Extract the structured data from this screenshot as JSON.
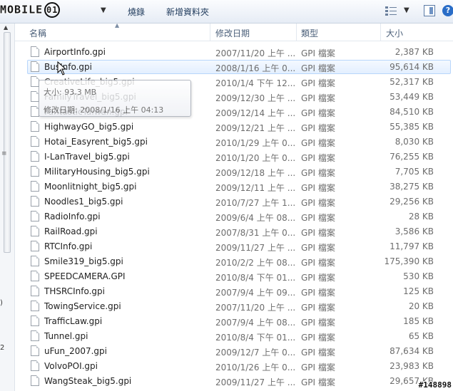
{
  "toolbar": {
    "logo_text": "MOBILE",
    "logo_ring": "01",
    "organize_label": "組合管理",
    "burn_label": "燒錄",
    "new_folder_label": "新增資料夾"
  },
  "left_strip_glyphs": [
    ")",
    "2"
  ],
  "columns": {
    "name": "名稱",
    "date": "修改日期",
    "type": "類型",
    "size": "大小"
  },
  "files": [
    {
      "name": "AirportInfo.gpi",
      "date": "2007/11/20 上午 ...",
      "type": "GPI 檔案",
      "size": "2,387 KB"
    },
    {
      "name": "BusInfo.gpi",
      "date": "2008/1/16 上午 0...",
      "type": "GPI 檔案",
      "size": "95,614 KB"
    },
    {
      "name": "CreativeLife_big5.gpi",
      "date": "2010/1/4 下午 12...",
      "type": "GPI 檔案",
      "size": "52,317 KB"
    },
    {
      "name": "FamilyTravel_big5.gpi",
      "date": "2009/12/30 上午 ...",
      "type": "GPI 檔案",
      "size": "53,449 KB"
    },
    {
      "name": "FantasticTaiwan.gpi",
      "date": "2009/12/14 上午 ...",
      "type": "GPI 檔案",
      "size": "84,510 KB"
    },
    {
      "name": "HighwayGO_big5.gpi",
      "date": "2009/12/21 上午 ...",
      "type": "GPI 檔案",
      "size": "55,385 KB"
    },
    {
      "name": "Hotai_Easyrent_big5.gpi",
      "date": "2010/1/29 上午 0...",
      "type": "GPI 檔案",
      "size": "8,030 KB"
    },
    {
      "name": "I-LanTravel_big5.gpi",
      "date": "2010/1/20 上午 0...",
      "type": "GPI 檔案",
      "size": "76,255 KB"
    },
    {
      "name": "MilitaryHousing_big5.gpi",
      "date": "2009/12/18 上午 ...",
      "type": "GPI 檔案",
      "size": "7,705 KB"
    },
    {
      "name": "Moonlitnight_big5.gpi",
      "date": "2009/12/11 上午 ...",
      "type": "GPI 檔案",
      "size": "38,275 KB"
    },
    {
      "name": "Noodles1_big5.gpi",
      "date": "2010/7/27 上午 1...",
      "type": "GPI 檔案",
      "size": "29,256 KB"
    },
    {
      "name": "RadioInfo.gpi",
      "date": "2009/6/4 上午 08...",
      "type": "GPI 檔案",
      "size": "28 KB"
    },
    {
      "name": "RailRoad.gpi",
      "date": "2007/8/31 上午 0...",
      "type": "GPI 檔案",
      "size": "3,586 KB"
    },
    {
      "name": "RTCInfo.gpi",
      "date": "2009/11/27 上午 ...",
      "type": "GPI 檔案",
      "size": "11,797 KB"
    },
    {
      "name": "Smile319_big5.gpi",
      "date": "2010/2/2 上午 08...",
      "type": "GPI 檔案",
      "size": "175,390 KB"
    },
    {
      "name": "SPEEDCAMERA.GPI",
      "date": "2010/8/4 下午 01...",
      "type": "GPI 檔案",
      "size": "530 KB"
    },
    {
      "name": "THSRCInfo.gpi",
      "date": "2007/9/4 上午 09...",
      "type": "GPI 檔案",
      "size": "125 KB"
    },
    {
      "name": "TowingService.gpi",
      "date": "2007/11/20 上午 ...",
      "type": "GPI 檔案",
      "size": "20 KB"
    },
    {
      "name": "TrafficLaw.gpi",
      "date": "2007/9/4 上午 08...",
      "type": "GPI 檔案",
      "size": "185 KB"
    },
    {
      "name": "Tunnel.gpi",
      "date": "2010/8/4 下午 01...",
      "type": "GPI 檔案",
      "size": "65 KB"
    },
    {
      "name": "uFun_2007.gpi",
      "date": "2009/12/7 上午 0...",
      "type": "GPI 檔案",
      "size": "87,634 KB"
    },
    {
      "name": "VolvoPOI.gpi",
      "date": "2010/1/26 上午 0...",
      "type": "GPI 檔案",
      "size": "23,983 KB"
    },
    {
      "name": "WangSteak_big5.gpi",
      "date": "2009/11/27 上午 ...",
      "type": "GPI 檔案",
      "size": "29,657 KB"
    }
  ],
  "hover_index": 1,
  "tooltip": {
    "line1": "大小: 93.3 MB",
    "line2": "修改日期: 2008/1/16 上午 04:13"
  },
  "watermark": "#148898"
}
